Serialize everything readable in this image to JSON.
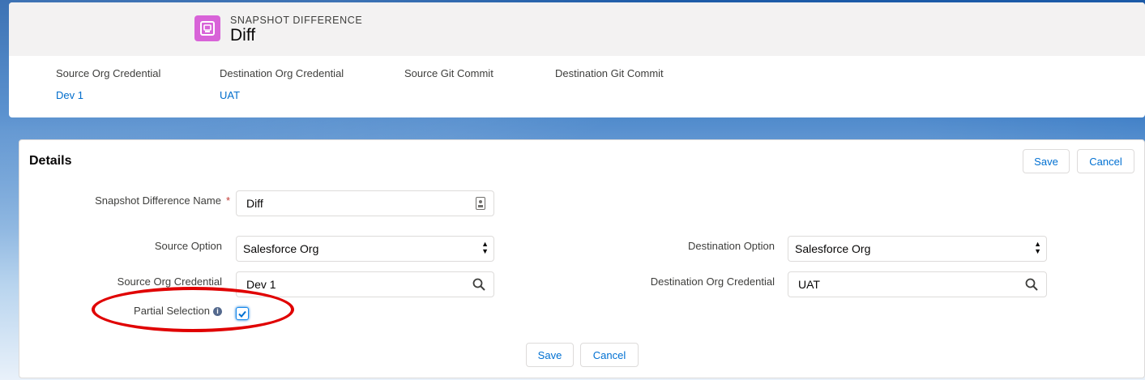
{
  "header": {
    "object_type": "Snapshot Difference",
    "title": "Diff",
    "fields": [
      {
        "label": "Source Org Credential",
        "value": "Dev 1"
      },
      {
        "label": "Destination Org Credential",
        "value": "UAT"
      },
      {
        "label": "Source Git Commit",
        "value": ""
      },
      {
        "label": "Destination Git Commit",
        "value": ""
      }
    ]
  },
  "card": {
    "title": "Details",
    "save_label": "Save",
    "cancel_label": "Cancel",
    "bottom_save_label": "Save",
    "bottom_cancel_label": "Cancel"
  },
  "form": {
    "name": {
      "label": "Snapshot Difference Name",
      "required_marker": "*",
      "value": "Diff"
    },
    "source_option": {
      "label": "Source Option",
      "value": "Salesforce Org"
    },
    "destination_option": {
      "label": "Destination Option",
      "value": "Salesforce Org"
    },
    "source_credential": {
      "label": "Source Org Credential",
      "value": "Dev 1"
    },
    "destination_credential": {
      "label": "Destination Org Credential",
      "value": "UAT"
    },
    "partial_selection": {
      "label": "Partial Selection",
      "checked": true
    }
  },
  "icons": {
    "object": "snapshot-icon",
    "lookup": "search-icon",
    "info": "info-icon",
    "field_lookup": "contact-card-icon",
    "select": "select-arrows-icon"
  },
  "colors": {
    "brand_blue": "#0070d2",
    "object_icon": "#d863d8",
    "annotation": "#e00000"
  }
}
